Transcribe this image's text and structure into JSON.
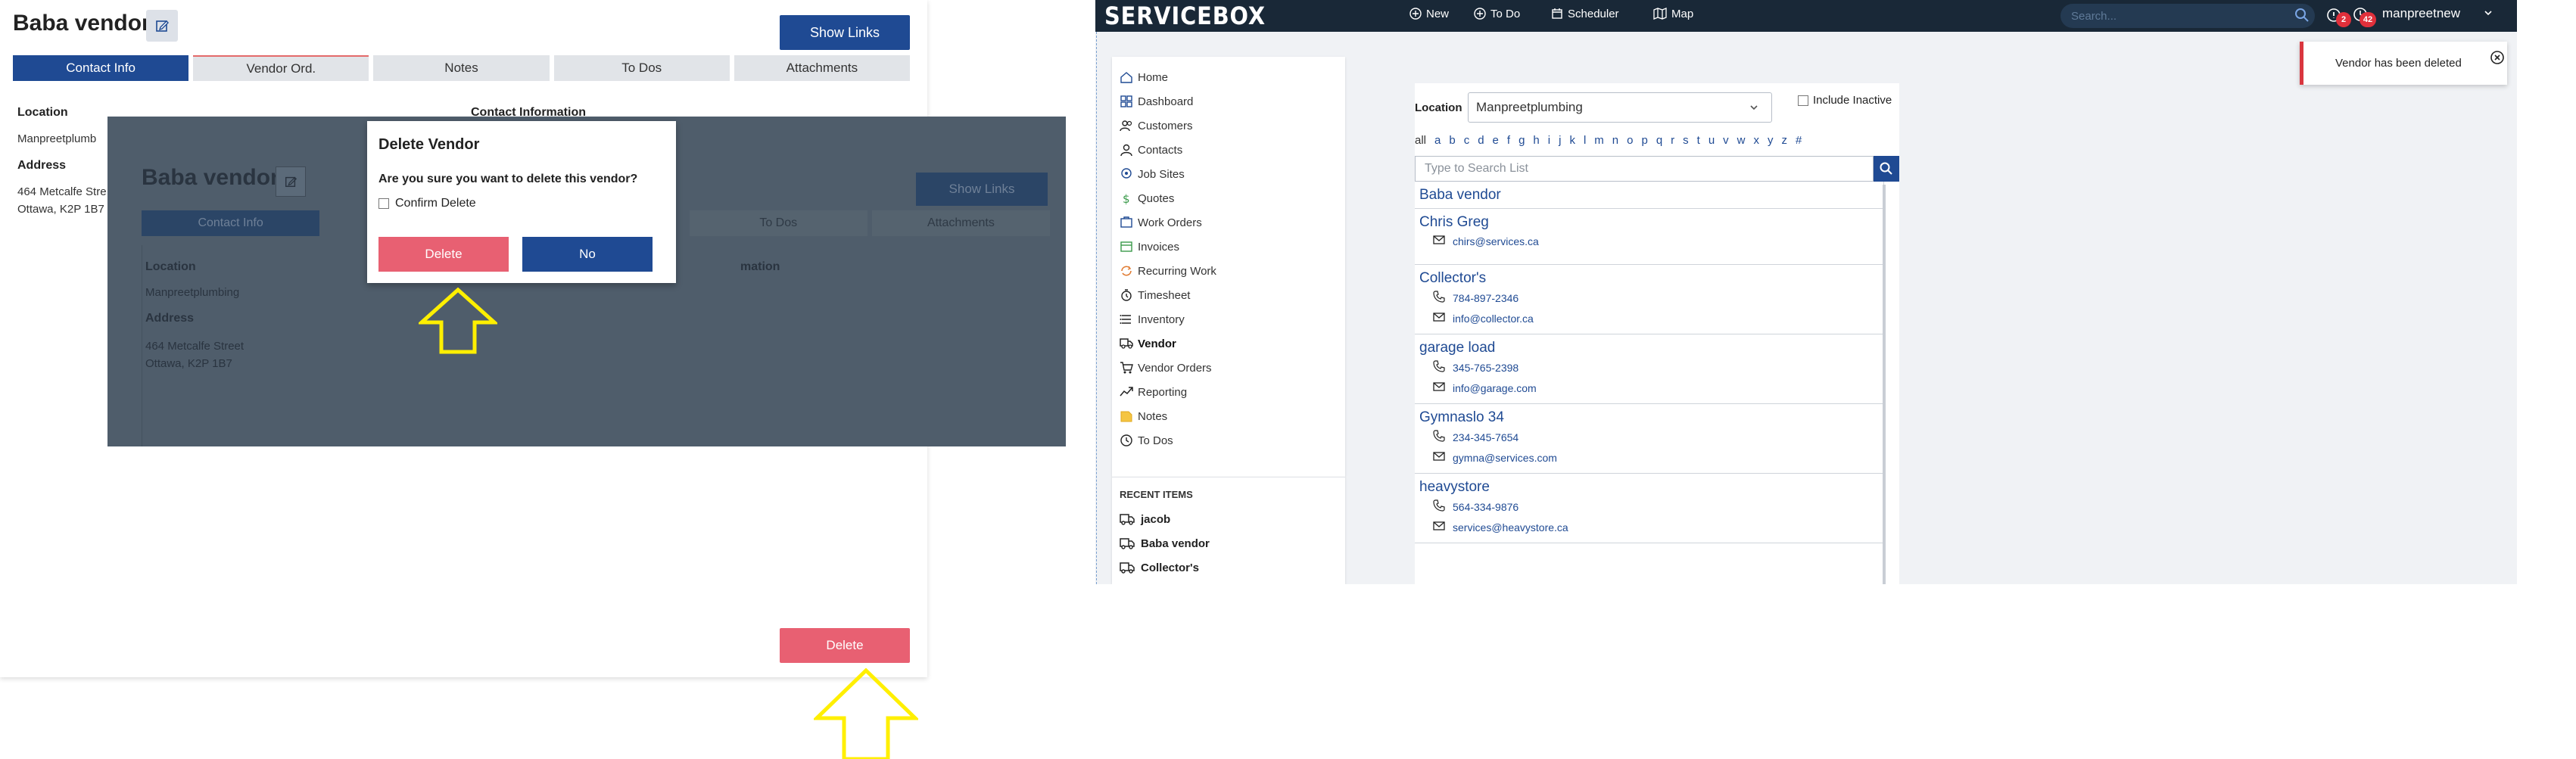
{
  "left_panel": {
    "title": "Baba vendor",
    "show_links": "Show Links",
    "tabs": [
      "Contact Info",
      "Vendor Ord.",
      "Notes",
      "To Dos",
      "Attachments"
    ],
    "location_label": "Location",
    "contact_info_label": "Contact Information",
    "location_value": "Manpreetplumbing",
    "location_value_clipped": "Manpreetplumb",
    "address_label": "Address",
    "address_line1": "464 Metcalfe Street",
    "address_line1_clipped": "464 Metcalfe Stre",
    "address_line2": "Ottawa, K2P 1B7",
    "delete_button": "Delete"
  },
  "overlay_label_partial": "mation",
  "dialog": {
    "title": "Delete Vendor",
    "question": "Are you sure you want to delete this vendor?",
    "confirm_label": "Confirm Delete",
    "delete_button": "Delete",
    "no_button": "No"
  },
  "app": {
    "logo": "SERVICEBOX",
    "topbar": {
      "new_label": "New",
      "todo_label": "To Do",
      "scheduler_label": "Scheduler",
      "map_label": "Map",
      "search_placeholder": "Search...",
      "badge_alerts": "2",
      "badge_clock": "42",
      "username": "manpreetnew"
    },
    "nav": [
      {
        "label": "Home",
        "icon": "home-icon"
      },
      {
        "label": "Dashboard",
        "icon": "dashboard-icon"
      },
      {
        "label": "Customers",
        "icon": "customers-icon"
      },
      {
        "label": "Contacts",
        "icon": "contacts-icon"
      },
      {
        "label": "Job Sites",
        "icon": "jobsites-icon"
      },
      {
        "label": "Quotes",
        "icon": "quotes-icon"
      },
      {
        "label": "Work Orders",
        "icon": "workorders-icon"
      },
      {
        "label": "Invoices",
        "icon": "invoices-icon"
      },
      {
        "label": "Recurring Work",
        "icon": "recurring-icon"
      },
      {
        "label": "Timesheet",
        "icon": "timesheet-icon"
      },
      {
        "label": "Inventory",
        "icon": "inventory-icon"
      },
      {
        "label": "Vendor",
        "icon": "vendor-icon"
      },
      {
        "label": "Vendor Orders",
        "icon": "vendor-orders-icon"
      },
      {
        "label": "Reporting",
        "icon": "reporting-icon"
      },
      {
        "label": "Notes",
        "icon": "notes-icon"
      },
      {
        "label": "To Dos",
        "icon": "todos-icon"
      }
    ],
    "active_nav": "Vendor",
    "recent": {
      "title": "RECENT ITEMS",
      "items": [
        "jacob",
        "Baba vendor",
        "Collector's"
      ]
    },
    "vendor_list": {
      "location_label": "Location",
      "location_value": "Manpreetplumbing",
      "include_inactive": "Include Inactive",
      "alphabet": [
        "all",
        "a",
        "b",
        "c",
        "d",
        "e",
        "f",
        "g",
        "h",
        "i",
        "j",
        "k",
        "l",
        "m",
        "n",
        "o",
        "p",
        "q",
        "r",
        "s",
        "t",
        "u",
        "v",
        "w",
        "x",
        "y",
        "z",
        "#"
      ],
      "search_placeholder": "Type to Search List",
      "entries": [
        {
          "name": "Baba vendor",
          "phone": "",
          "email": ""
        },
        {
          "name": "Chris Greg",
          "phone": "",
          "email": "chirs@services.ca"
        },
        {
          "name": "Collector's",
          "phone": "784-897-2346",
          "email": "info@collector.ca"
        },
        {
          "name": "garage load",
          "phone": "345-765-2398",
          "email": "info@garage.com"
        },
        {
          "name": "Gymnaslo 34",
          "phone": "234-345-7654",
          "email": "gymna@services.com"
        },
        {
          "name": "heavystore",
          "phone": "564-334-9876",
          "email": "services@heavystore.ca"
        }
      ]
    },
    "toast": {
      "message": "Vendor has been deleted"
    }
  },
  "colors": {
    "primary": "#1f4a93",
    "danger": "#e86072",
    "topbar": "#192837",
    "arrow": "#ffef00"
  }
}
